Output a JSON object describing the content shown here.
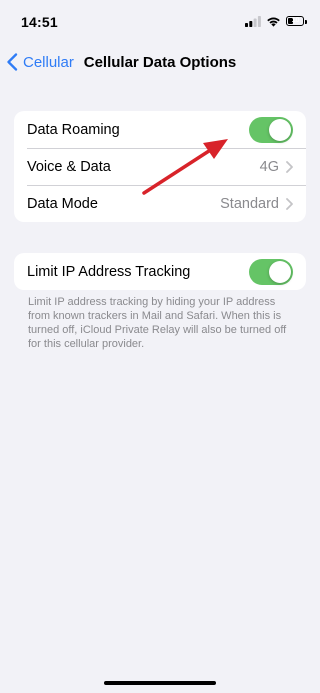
{
  "status": {
    "time": "14:51",
    "battery": "10",
    "icons": [
      "signal-icon",
      "wifi-icon",
      "battery-icon"
    ]
  },
  "nav": {
    "back_label": "Cellular",
    "title": "Cellular Data Options"
  },
  "group1": {
    "rows": [
      {
        "label": "Data Roaming",
        "control": "toggle",
        "state": true
      },
      {
        "label": "Voice & Data",
        "value": "4G"
      },
      {
        "label": "Data Mode",
        "value": "Standard"
      }
    ]
  },
  "group2": {
    "rows": [
      {
        "label": "Limit IP Address Tracking",
        "control": "toggle",
        "state": true
      }
    ],
    "footer": "Limit IP address tracking by hiding your IP address from known trackers in Mail and Safari. When this is turned off, iCloud Private Relay will also be turned off for this cellular provider."
  },
  "colors": {
    "accent": "#2f7cf6",
    "toggle_on": "#65c466",
    "annotation_arrow": "#d8232a",
    "background": "#f2f2f7"
  }
}
